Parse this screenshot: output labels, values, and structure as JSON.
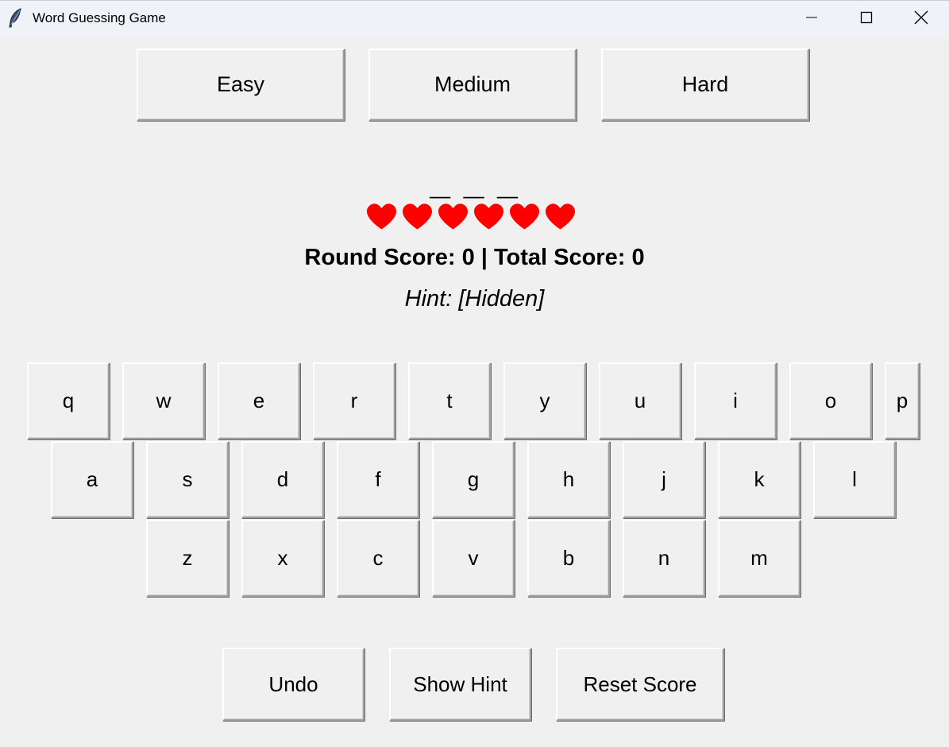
{
  "window": {
    "title": "Word Guessing Game",
    "icon": "feather-icon",
    "controls": [
      "minimize-icon",
      "maximize-icon",
      "close-icon"
    ]
  },
  "difficulty": {
    "easy": "Easy",
    "medium": "Medium",
    "hard": "Hard"
  },
  "game": {
    "word_display": "_ _ _",
    "lives": 6,
    "heart_color": "#ff0000",
    "score_text": "Round Score: 0 | Total Score: 0",
    "hint_text": "Hint: [Hidden]"
  },
  "keyboard": {
    "row1": [
      "q",
      "w",
      "e",
      "r",
      "t",
      "y",
      "u",
      "i",
      "o",
      "p"
    ],
    "row2": [
      "a",
      "s",
      "d",
      "f",
      "g",
      "h",
      "j",
      "k",
      "l"
    ],
    "row3": [
      "z",
      "x",
      "c",
      "v",
      "b",
      "n",
      "m"
    ]
  },
  "actions": {
    "undo": "Undo",
    "show_hint": "Show Hint",
    "reset_score": "Reset Score"
  }
}
